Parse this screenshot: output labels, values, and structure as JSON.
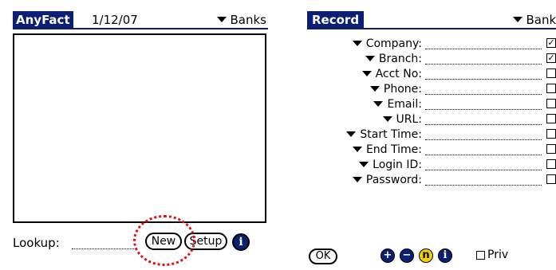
{
  "left_screen": {
    "app_title": "AnyFact",
    "date": "1/12/07",
    "category": "Banks",
    "lookup_label": "Lookup:",
    "buttons": {
      "new": "New",
      "setup": "Setup",
      "info": "i"
    }
  },
  "right_screen": {
    "title": "Record",
    "category": "Banks",
    "fields": [
      {
        "label": "Company:",
        "checked": true
      },
      {
        "label": "Branch:",
        "checked": true
      },
      {
        "label": "Acct No:",
        "checked": false
      },
      {
        "label": "Phone:",
        "checked": false
      },
      {
        "label": "Email:",
        "checked": false
      },
      {
        "label": "URL:",
        "checked": false
      },
      {
        "label": "Start Time:",
        "checked": false
      },
      {
        "label": "End Time:",
        "checked": false
      },
      {
        "label": "Login ID:",
        "checked": false
      },
      {
        "label": "Password:",
        "checked": false
      }
    ],
    "buttons": {
      "ok": "OK",
      "add": "+",
      "remove": "−",
      "note": "n",
      "info": "i"
    },
    "priv_label": "Priv",
    "priv_checked": false
  },
  "colors": {
    "titlebar": "#0d1f73",
    "highlight": "#e01010",
    "note": "#f1d200"
  }
}
